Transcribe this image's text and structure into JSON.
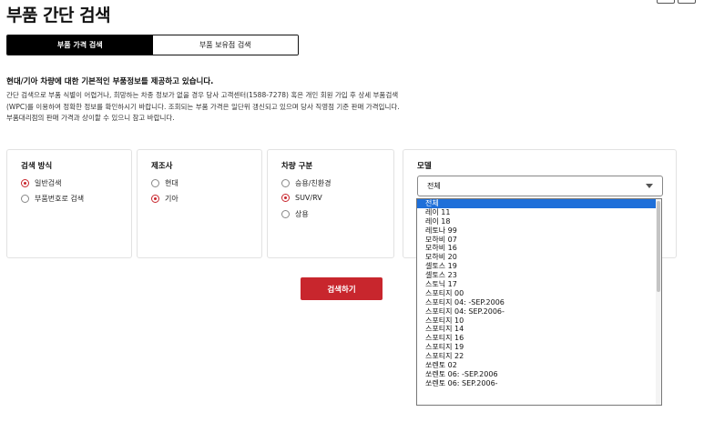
{
  "page": {
    "title": "부품 간단 검색"
  },
  "tabs": [
    {
      "label": "부품 가격 검색",
      "active": true
    },
    {
      "label": "부품 보유점 검색",
      "active": false
    }
  ],
  "intro": {
    "heading": "현대/기아 차량에 대한 기본적인 부품정보를 제공하고 있습니다.",
    "lines": [
      "간단 검색으로 부품 식별이 어렵거나, 희망하는 차종 정보가 없을 경우 당사 고객센터(1588-7278) 혹은 개인 회원 가입 후 상세 부품검색",
      "(WPC)를 이용하여 정확한 정보를 확인하시기 바랍니다. 조회되는 부품 가격은 일단위 갱신되고 있으며 당사 직영점 기준 판매 가격입니다.",
      "부품대리점의 판매 가격과 상이할 수 있으니 참고 바랍니다."
    ]
  },
  "search_method": {
    "title": "검색 방식",
    "options": [
      {
        "label": "일반검색",
        "checked": true
      },
      {
        "label": "부품번호로 검색",
        "checked": false
      }
    ]
  },
  "manufacturer": {
    "title": "제조사",
    "options": [
      {
        "label": "현대",
        "checked": false
      },
      {
        "label": "기아",
        "checked": true
      }
    ]
  },
  "vehicle_type": {
    "title": "차량 구분",
    "options": [
      {
        "label": "승용/친환경",
        "checked": false
      },
      {
        "label": "SUV/RV",
        "checked": true
      },
      {
        "label": "상용",
        "checked": false
      }
    ]
  },
  "model": {
    "title": "모델",
    "selected": "전체",
    "options": [
      "전체",
      "레이 11",
      "레이 18",
      "레토나 99",
      "모하비 07",
      "모하비 16",
      "모하비 20",
      "셀토스 19",
      "셀토스 23",
      "스토닉 17",
      "스포티지 00",
      "스포티지 04: -SEP.2006",
      "스포티지 04: SEP.2006-",
      "스포티지 10",
      "스포티지 14",
      "스포티지 16",
      "스포티지 19",
      "스포티지 22",
      "쏘렌토 02",
      "쏘렌토 06: -SEP.2006",
      "쏘렌토 06: SEP.2006-"
    ]
  },
  "search_button": {
    "label": "검색하기"
  },
  "colors": {
    "accent": "#c8262d",
    "selection": "#1e6fd9"
  }
}
